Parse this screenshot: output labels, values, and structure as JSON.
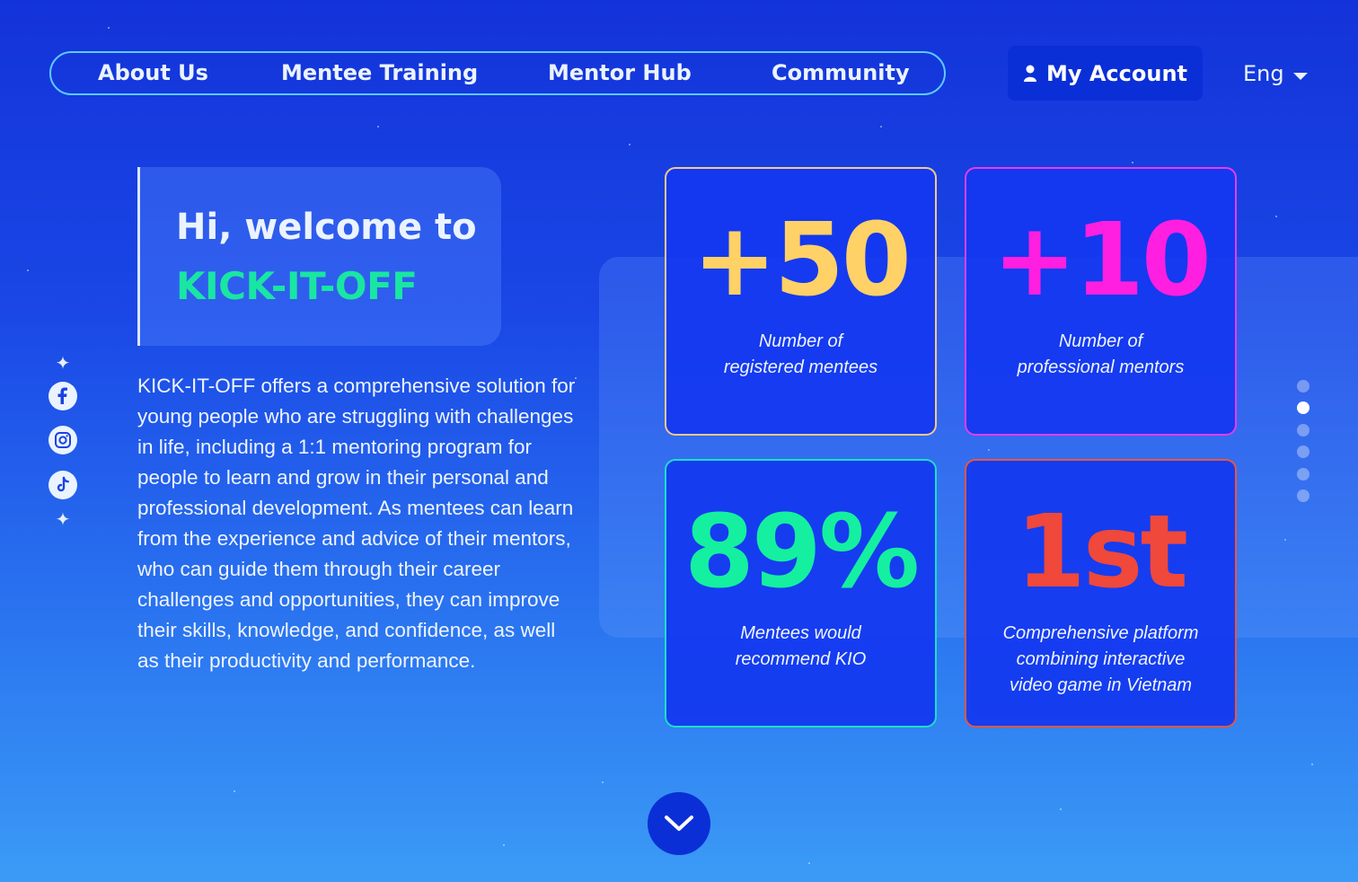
{
  "nav": {
    "items": [
      {
        "label": "About Us"
      },
      {
        "label": "Mentee Training"
      },
      {
        "label": "Mentor Hub"
      },
      {
        "label": "Community"
      }
    ],
    "account_label": "My Account",
    "account_icon": "user-icon",
    "language": "Eng",
    "language_icon": "caret-down-icon"
  },
  "hero": {
    "greeting": "Hi, welcome to",
    "brand": "KICK-IT-OFF",
    "description": "KICK-IT-OFF offers a comprehensive solution for young people who are struggling with challenges in life, including a 1:1 mentoring program for people to learn and grow in their personal and professional development. As mentees can learn from the experience and advice of their mentors, who can guide them through their career challenges and opportunities, they can improve their skills, knowledge, and confidence, as well as their productivity and performance."
  },
  "social": {
    "icons": [
      "sparkle-icon",
      "facebook-icon",
      "instagram-icon",
      "tiktok-icon",
      "sparkle-icon"
    ]
  },
  "stats": [
    {
      "value": "+50",
      "label_line1": "Number of",
      "label_line2": "registered mentees",
      "label_line3": "",
      "color": "#ffd166",
      "border": "#f4c98a"
    },
    {
      "value": "+10",
      "label_line1": "Number of",
      "label_line2": "professional mentors",
      "label_line3": "",
      "color": "#ff1fe0",
      "border": "#e63cf0"
    },
    {
      "value": "89%",
      "label_line1": "Mentees would",
      "label_line2": "recommend KIO",
      "label_line3": "",
      "color": "#14f0a0",
      "border": "#19e0c8"
    },
    {
      "value": "1st",
      "label_line1": "Comprehensive platform",
      "label_line2": "combining interactive",
      "label_line3": "video game in Vietnam",
      "color": "#f0483a",
      "border": "#e8573f"
    }
  ],
  "pagination": {
    "total": 6,
    "active_index": 1
  },
  "scroll": {
    "icon": "chevron-down-icon"
  }
}
